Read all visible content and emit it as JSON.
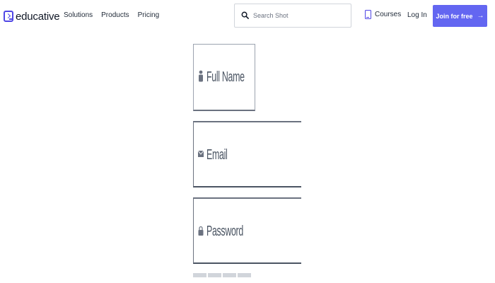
{
  "header": {
    "logo_text": "educative",
    "nav": [
      "Solutions",
      "Products",
      "Pricing"
    ],
    "search": {
      "placeholder": "Search Shot",
      "value": ""
    },
    "courses_label": "Courses",
    "login_label": "Log In",
    "join_label": "Join for free",
    "join_arrow": "→",
    "accent_color": "#6366f1"
  },
  "form": {
    "fields": [
      {
        "label": "Full Name",
        "icon": "person-icon"
      },
      {
        "label": "Email",
        "icon": "envelope-icon"
      },
      {
        "label": "Password",
        "icon": "lock-icon"
      }
    ],
    "placeholder_bar_count": 4
  }
}
